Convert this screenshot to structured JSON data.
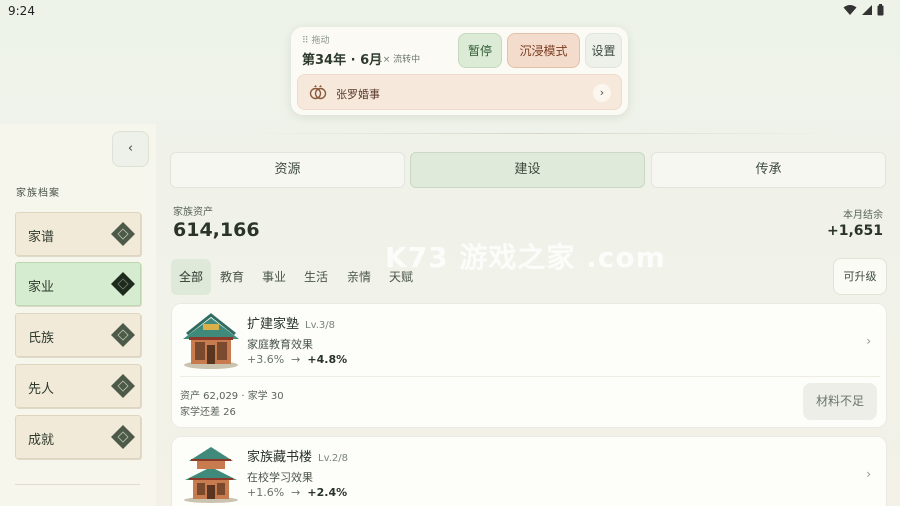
{
  "status_bar": {
    "time": "9:24"
  },
  "top_card": {
    "drag_label": "⠿ 拖动",
    "date": "第34年 · 6月",
    "speed": "1× 流转中",
    "pause_label": "暂停",
    "immerse_label": "沉浸模式",
    "settings_label": "设置",
    "event_label": "张罗婚事",
    "event_arrow": "›"
  },
  "sidebar": {
    "collapse_label": "‹",
    "title": "家族档案",
    "items": [
      {
        "label": "家谱",
        "active": false
      },
      {
        "label": "家业",
        "active": true
      },
      {
        "label": "氏族",
        "active": false
      },
      {
        "label": "先人",
        "active": false
      },
      {
        "label": "成就",
        "active": false
      }
    ]
  },
  "tabs": [
    {
      "label": "资源"
    },
    {
      "label": "建设"
    },
    {
      "label": "传承"
    }
  ],
  "summary": {
    "assets_label": "家族资产",
    "assets_value": "614,166",
    "monthly_label": "本月结余",
    "monthly_value": "+1,651"
  },
  "watermark": "K73 游戏之家 .com",
  "filters": [
    "全部",
    "教育",
    "事业",
    "生活",
    "亲情",
    "天赋"
  ],
  "upgrade_filter_label": "可升级",
  "buildings": [
    {
      "name": "扩建家塾",
      "level": "Lv.3/8",
      "effect": "家庭教育效果",
      "from": "+3.6%",
      "to": "+4.8%",
      "cost": "资产 62,029 · 家学 30",
      "shortage": "家学还差 26",
      "action_label": "材料不足"
    },
    {
      "name": "家族藏书楼",
      "level": "Lv.2/8",
      "effect": "在校学习效果",
      "from": "+1.6%",
      "to": "+2.4%"
    }
  ],
  "arrow_symbol": "→",
  "chevron": "›"
}
